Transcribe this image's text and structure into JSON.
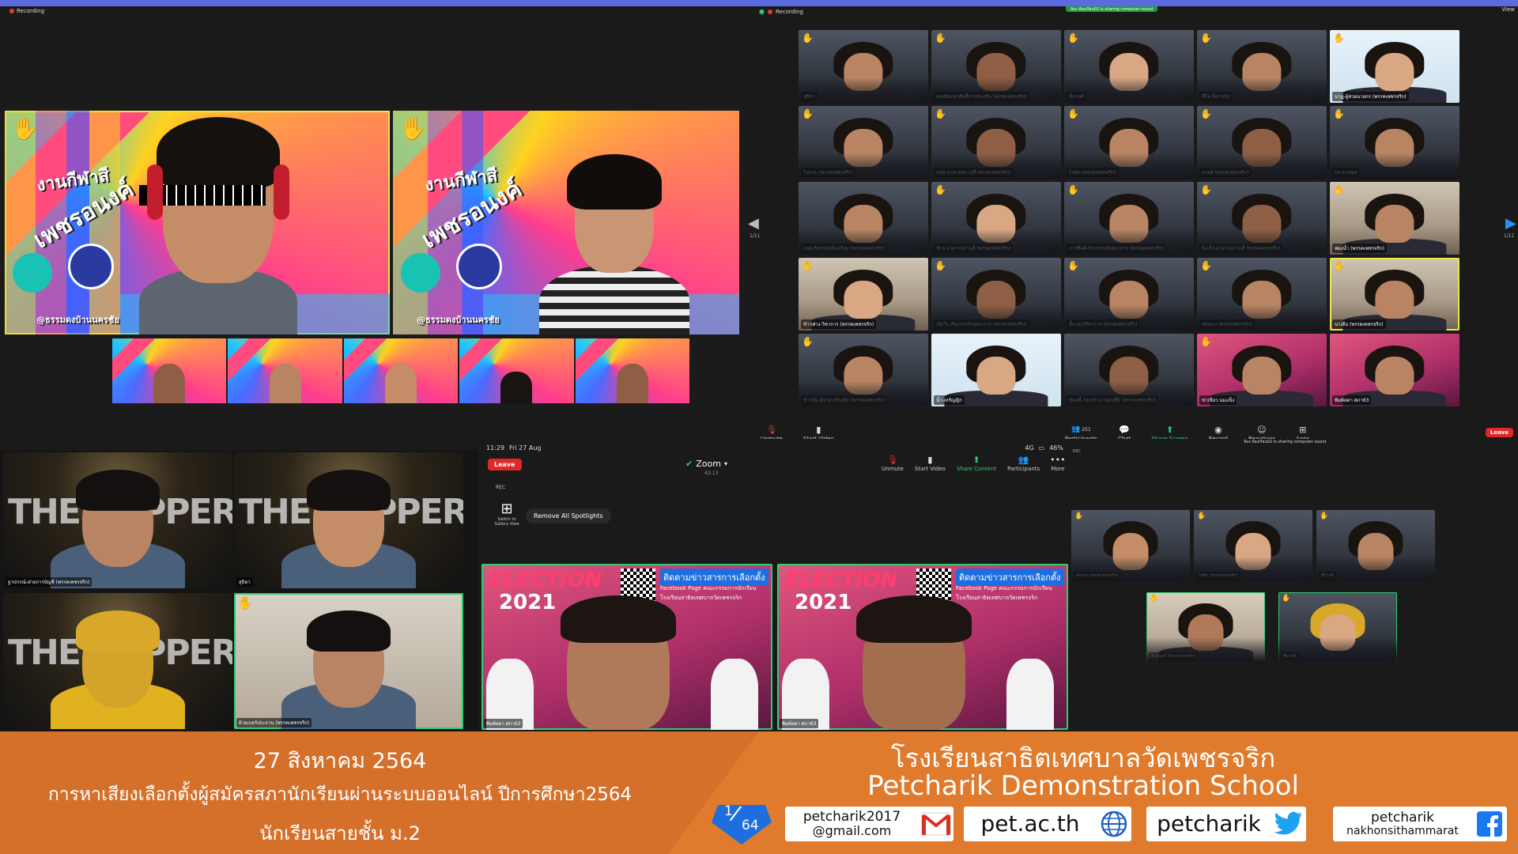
{
  "top_bar": {
    "recording_left": "Recording",
    "recording_right": "Recording",
    "sharing_notice": "ห้อง ห้องเรียน02 is sharing computer sound",
    "view_label": "View"
  },
  "left_share": {
    "main_tiles": [
      {
        "title": "งานกีฬาสี",
        "subtitle": "เพชรอนงค์",
        "caption": "@ธรรมดงบ้านนครชัย"
      },
      {
        "title": "งานกีฬาสี",
        "subtitle": "เพชรอนงค์",
        "caption": "@ธรรมดงบ้านนครชัย"
      }
    ],
    "filmstrip_count": 5
  },
  "gallery": {
    "page_indicator_left": "1/11",
    "page_indicator_right": "1/11",
    "tiles": [
      {
        "name": "สุธิดา"
      },
      {
        "name": "คุณนันทนาศักดิ์การส่งเสริม (พรรคเพชรจริก)"
      },
      {
        "name": "ที่มากดี"
      },
      {
        "name": "ฟีโอ ที่มาก02"
      },
      {
        "name": "นาฎ-ผู้ช่วยนายกร (พรรคเพชรจริก)"
      },
      {
        "name": "ไข่ปาบ (พรรคเพชรจริก)"
      },
      {
        "name": "หนุ่ย-อาคารสถานที่ (พรรคเพชรจริก)"
      },
      {
        "name": "ไข่ต้ม (พรรคเพชรจริก)"
      },
      {
        "name": "มายด์ (พรรคเพชรจริก)"
      },
      {
        "name": "ประมวลผล"
      },
      {
        "name": "กฤต-กิจกรรมห้องเรียน (พรรคเพชรจริก)"
      },
      {
        "name": "ฟ้าอ-อาคารสถานที่ (พรรคเพชรจริก)"
      },
      {
        "name": "การฟิตต์-กิจกรรมนันทนาการ (พรรคเพชรจริก)"
      },
      {
        "name": "บุ้งเล็ก-อาคารสถานที่ (พรรคเพชรจริก)"
      },
      {
        "name": "ฟองน้ำ (พรรคเพชรจริก)"
      },
      {
        "name": "ข้าวฟ่าง-วิชาการ (พรรคเพชรจริก)"
      },
      {
        "name": "เปียโน-กิจกรรมนันทนาการ (พรรคเพชรจริก)"
      },
      {
        "name": "มิ้น-ฝ่ายวิชาการ (พรรคเพชรจริก)"
      },
      {
        "name": "ห่อหมก (พรรคเพชรจริก)"
      },
      {
        "name": "นาเดีย (พรรคเพชรจริก)"
      },
      {
        "name": "ข้าวปุ้น-ผู้ช่วยเหรัญญิก (พรรคเพชรจริก)"
      },
      {
        "name": "น้ำ-เหรัญญิก"
      },
      {
        "name": "มัดหมี่-รองประธานคนที่2 (พรรคเพชรจริก)"
      },
      {
        "name": "ชาเขียว นมแข็ง"
      },
      {
        "name": "พิมพ์ลดา ศภา63"
      }
    ]
  },
  "zoom_toolbar": {
    "unmute": "Unmute",
    "start_video": "Start Video",
    "participants": "Participants",
    "participants_count": "251",
    "chat": "Chat",
    "share_screen": "Share Screen",
    "record": "Record",
    "reactions": "Reactions",
    "apps": "Apps",
    "leave": "Leave"
  },
  "bottom_left_tiles": [
    {
      "name": "ฐาปกรณ์-ฝ่ายการบัญชี (พรรคเพชรจริก)",
      "bg": "THE RAPPER"
    },
    {
      "name": "สุธิดา",
      "bg": "THE RAPPER"
    },
    {
      "name": "",
      "bg": "THE RAPPER"
    },
    {
      "name": "ฝ้ายเบอร์ประธาน (พรรคเพชรจริก)",
      "bg": ""
    }
  ],
  "phone": {
    "time": "11:29",
    "date": "Fri 27 Aug",
    "signal": "4G",
    "battery": "46%",
    "leave": "Leave",
    "zoom_label": "Zoom",
    "zoom_timer": "42:13",
    "rec": "REC",
    "unmute": "Unmute",
    "start_video": "Start Video",
    "share_content": "Share Content",
    "participants": "Participants",
    "more": "More",
    "switch_gallery": "Switch to Gallery View",
    "remove_spotlights": "Remove All Spotlights",
    "tiles": [
      {
        "banner": "ELECTION",
        "year": "2021",
        "info": "ติดตามข่าวสารการเลือกตั้ง",
        "info2": "Facebook Page คณะกรรมการนักเรียน",
        "info3": "โรงเรียนสาธิตเทศบาลวัดเพชรจริก",
        "name": "พิมพ์ลดา ศภา63"
      },
      {
        "banner": "ELECTION",
        "year": "2021",
        "info": "ติดตามข่าวสารการเลือกตั้ง",
        "info2": "Facebook Page คณะกรรมการนักเรียน",
        "info3": "โรงเรียนสาธิตเทศบาลวัดเพชรจริก",
        "name": "พิมพ์ลดา ศภา63"
      }
    ]
  },
  "right_panel": {
    "sharing_notice": "ห้อง ห้องเรียน02 is sharing computer sound",
    "rec": "REC",
    "tiles": [
      {
        "name": "ห่อหมก (พรรคเพชรจริก)"
      },
      {
        "name": "ไข่ต้ม (พรรคเพชรจริก)"
      },
      {
        "name": "ที่มากดี"
      },
      {
        "name": "ฝ้ายเบอร์ (พรรคเพชรจริก)"
      },
      {
        "name": "ที่มากดี"
      }
    ]
  },
  "footer": {
    "date": "27 สิงหาคม 2564",
    "event": "การหาเสียงเลือกตั้งผู้สมัครสภานักเรียนผ่านระบบออนไลน์ ปีการศึกษา2564",
    "grade": "นักเรียนสายชั้น ม.2",
    "page_num": "1",
    "page_total": "64",
    "school_th": "โรงเรียนสาธิตเทศบาลวัดเพชรจริก",
    "school_en": "Petcharik Demonstration School",
    "social": [
      {
        "label1": "petcharik2017",
        "label2": "@gmail.com",
        "icon": "gmail-icon"
      },
      {
        "label1": "pet.ac.th",
        "label2": "",
        "icon": "globe-icon"
      },
      {
        "label1": "petcharik",
        "label2": "",
        "icon": "twitter-icon"
      },
      {
        "label1": "petcharik",
        "label2": "nakhonsithammarat",
        "icon": "facebook-icon"
      }
    ]
  }
}
